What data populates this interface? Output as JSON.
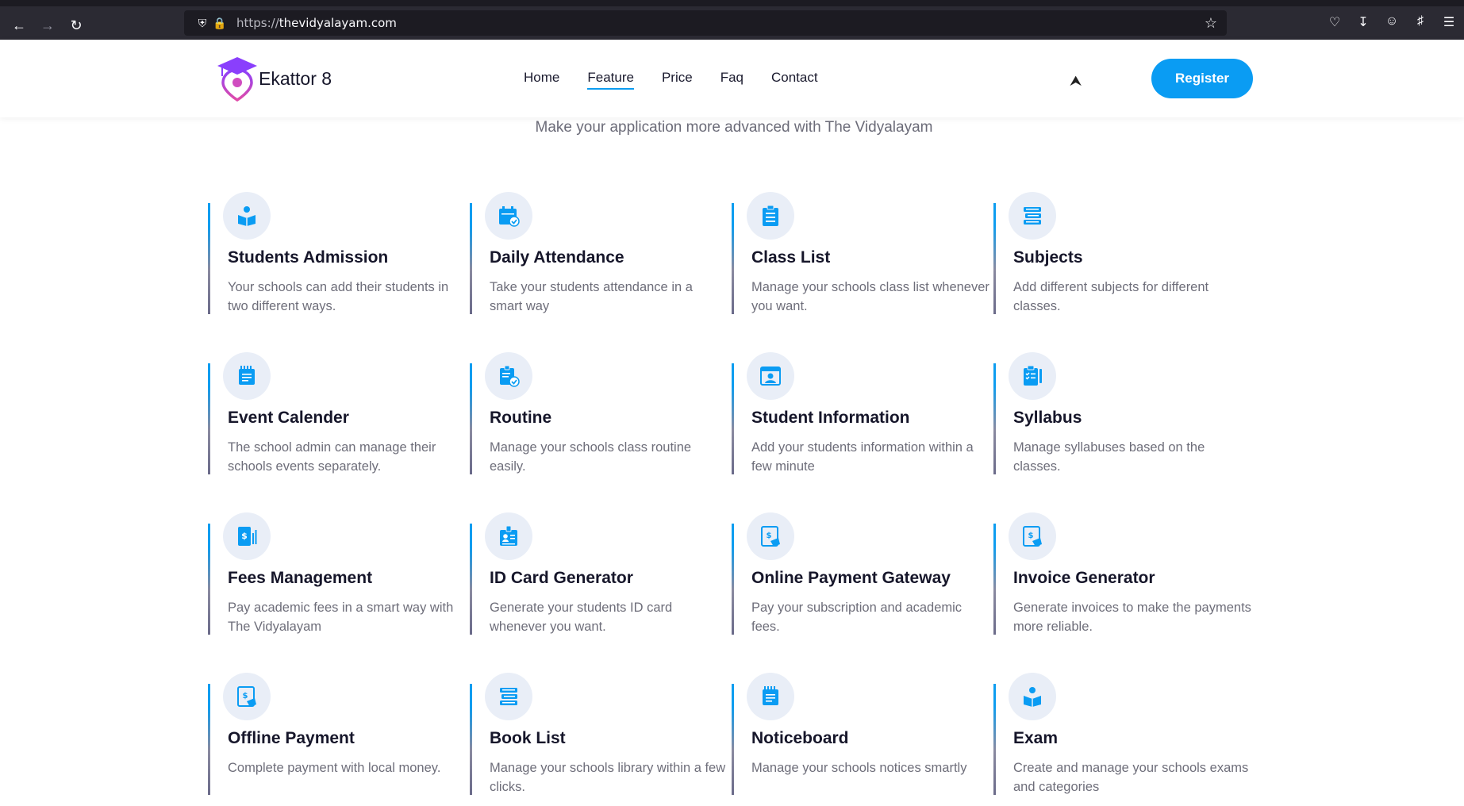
{
  "browser": {
    "url_prefix": "https://",
    "url_host": "thevidyalayam.com"
  },
  "header": {
    "logo_name": "Ekattor 8",
    "nav": [
      {
        "label": "Home",
        "active": false
      },
      {
        "label": "Feature",
        "active": true
      },
      {
        "label": "Price",
        "active": false
      },
      {
        "label": "Faq",
        "active": false
      },
      {
        "label": "Contact",
        "active": false
      }
    ],
    "register_label": "Register"
  },
  "subtitle": "Make your application more advanced with The Vidyalayam",
  "colors": {
    "accent": "#0a9cf3",
    "icon_bg": "#e9eef7",
    "heading": "#16162a",
    "body_text": "#6e6e7a",
    "logo_purple": "#8a3ffc",
    "logo_pink": "#e04ba8"
  },
  "features": [
    {
      "title": "Students Admission",
      "desc": "Your schools can add their students in two different ways.",
      "icon": "reading-student-icon"
    },
    {
      "title": "Daily Attendance",
      "desc": "Take your students attendance in a smart way",
      "icon": "calendar-check-icon"
    },
    {
      "title": "Class List",
      "desc": "Manage your schools class list whenever you want.",
      "icon": "clipboard-list-icon"
    },
    {
      "title": "Subjects",
      "desc": "Add different subjects for different classes.",
      "icon": "book-stack-icon"
    },
    {
      "title": "Event Calender",
      "desc": "The school admin can manage their schools events separately.",
      "icon": "notepad-icon"
    },
    {
      "title": "Routine",
      "desc": "Manage your schools class routine easily.",
      "icon": "schedule-check-icon"
    },
    {
      "title": "Student Information",
      "desc": "Add your students information within a few minute",
      "icon": "student-profile-icon"
    },
    {
      "title": "Syllabus",
      "desc": "Manage syllabuses based on the classes.",
      "icon": "checklist-icon"
    },
    {
      "title": "Fees Management",
      "desc": "Pay academic fees in a smart way with The Vidyalayam",
      "icon": "fee-receipt-icon"
    },
    {
      "title": "ID Card Generator",
      "desc": "Generate your students ID card whenever you want.",
      "icon": "id-card-icon"
    },
    {
      "title": "Online Payment Gateway",
      "desc": "Pay your subscription and academic fees.",
      "icon": "online-payment-icon"
    },
    {
      "title": "Invoice Generator",
      "desc": "Generate invoices to make the payments more reliable.",
      "icon": "invoice-icon"
    },
    {
      "title": "Offline Payment",
      "desc": "Complete payment with local money.",
      "icon": "cash-payment-icon"
    },
    {
      "title": "Book List",
      "desc": "Manage your schools library within a few clicks.",
      "icon": "book-stack-icon"
    },
    {
      "title": "Noticeboard",
      "desc": "Manage your schools notices smartly",
      "icon": "notepad-icon"
    },
    {
      "title": "Exam",
      "desc": "Create and manage your schools exams and categories",
      "icon": "reading-student-icon"
    }
  ]
}
